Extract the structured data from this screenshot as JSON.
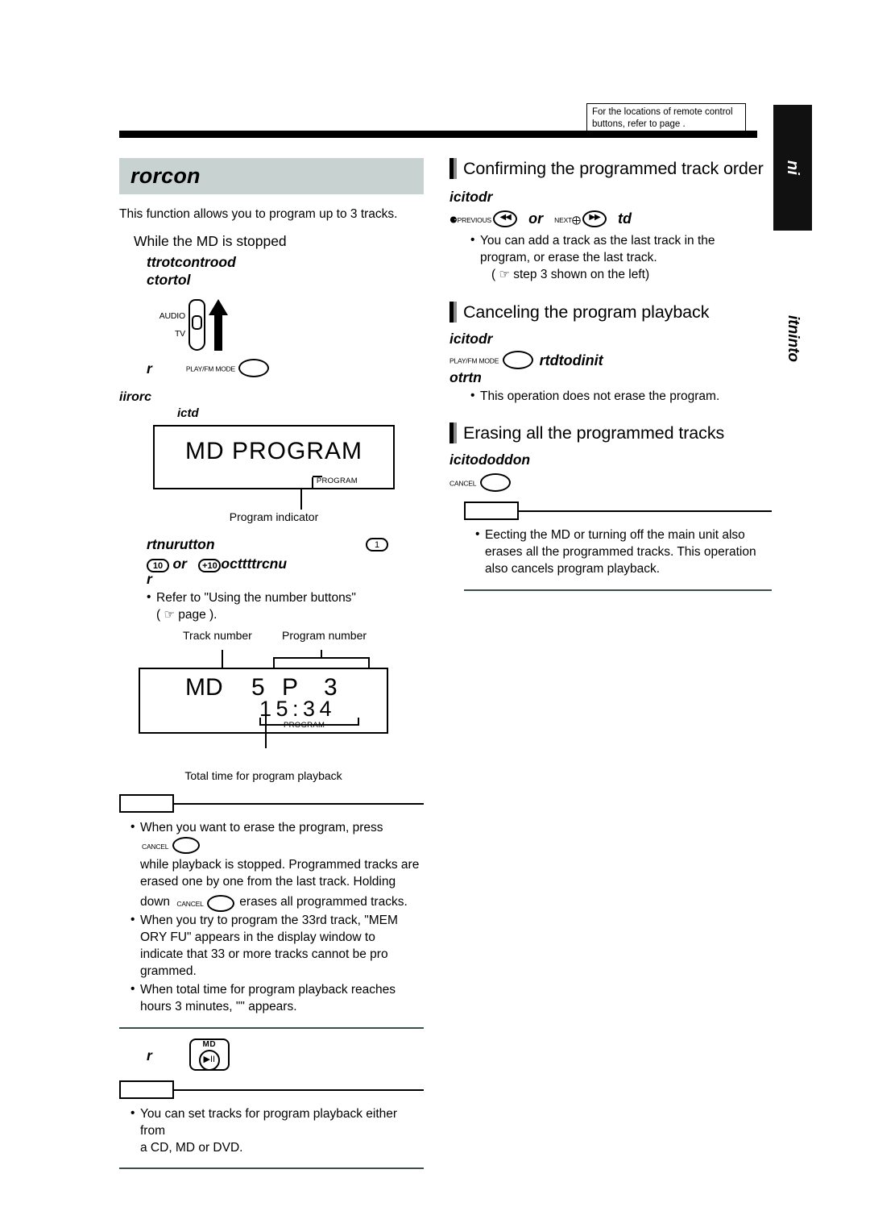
{
  "remote_note": {
    "line1": "For the locations of remote control",
    "line2": "buttons, refer to page ."
  },
  "side_tab": {
    "label": "ni",
    "sub_label": "itninto"
  },
  "left_column": {
    "chapter_title": "rorcon",
    "intro": "This function allows you to program up to 3 tracks.",
    "subhead": "While the MD is stopped",
    "step1_line1": "ttrotcontrood",
    "step1_line2": "ctortol",
    "switch": {
      "label_audio": "AUDIO",
      "label_tv": "TV"
    },
    "step2_prefix": "r",
    "step2_button_caption": "PLAY/FM MODE",
    "step2_note": "iirorc",
    "step2_note2": "ictd",
    "display1": {
      "text": "MD  PROGRAM",
      "program_tag": "PROGRAM",
      "caption": "Program indicator"
    },
    "step3_line1": "rtnurutton",
    "step3_button_1": "1",
    "step3_num_10": "10",
    "step3_or": "or",
    "step3_num_plus10": "+10",
    "step3_line2_tail": "octtttrcnu",
    "step3_line3": "r",
    "step3_bullet_1": "Refer to \"Using the number buttons\"",
    "step3_bullet_1b": "page ).",
    "display2": {
      "label_track": "Track number",
      "label_program": "Program number",
      "md": "MD",
      "track": "5",
      "p": "P",
      "prognum": "3",
      "time": "1 5 : 3 4",
      "program_tag": "PROGRAM",
      "caption": "Total time for program playback"
    },
    "note1": {
      "tab_label": "",
      "items": [
        "When you want to erase the program, press  ~CANCEL~  while playback is stopped. Programmed tracks are erased one by one from the last track. Holding down ~CANCEL~ erases all programmed tracks.",
        "When you try to program the 33rd track, \"MEM ORY FU\" appears in the display window to indicate that 33 or more tracks cannot be pro grammed.",
        "When total time for program playback reaches hours 3 minutes, \"\" appears."
      ],
      "item1_a": "When you want to erase the program, press",
      "item1_b": "while playback is stopped. Programmed tracks are",
      "item1_c": "erased one by one from the last track. Holding",
      "item1_d": "down",
      "item1_e": "erases all programmed tracks.",
      "item2_a": "When you try to program the 33rd track, \"MEM",
      "item2_b": "ORY FU\" appears in the display window to",
      "item2_c": "indicate that 33 or more tracks cannot be pro",
      "item2_d": "grammed.",
      "item3_a": "When total time for program playback reaches",
      "item3_b": "hours 3 minutes, \"\" appears."
    },
    "step4_prefix": "r",
    "step4_button_caption": "MD",
    "step4_button_glyph": "▶II",
    "note2": {
      "tab_label": "",
      "item_a": "You can set tracks for program playback either from",
      "item_b": "a CD, MD or DVD."
    },
    "cancel_caption": "CANCEL"
  },
  "right_column": {
    "section1": {
      "title": "Confirming the programmed track order",
      "step_label": "icitodr",
      "btn_prev_caption": "PREVIOUS",
      "btn_prev_glyph": "◀◀",
      "or": "or",
      "btn_next_caption": "NEXT",
      "btn_next_glyph": "▶▶",
      "tail": "td",
      "bullet_a": "You can add a track as the last track in the",
      "bullet_b": "program, or erase the last track.",
      "bullet_c": "step 3 shown on the left)"
    },
    "section2": {
      "title": "Canceling the program playback",
      "step_label": "icitodr",
      "btn_caption": "PLAY/FM MODE",
      "tail": "rtdtodinit",
      "tail2": "otrtn",
      "bullet_a": "This operation does not erase the program."
    },
    "section3": {
      "title": "Erasing all the programmed tracks",
      "step_label": "icitododdon",
      "btn_caption": "CANCEL",
      "note": {
        "tab_label": "",
        "item_a": "Eecting the MD or turning off the main unit also",
        "item_b": "erases all the programmed tracks. This operation",
        "item_c": "also cancels program playback."
      }
    }
  },
  "colors": {
    "chapter_bar_bg": "#c8d2d1",
    "section_bar_dark": "#000000",
    "section_bar_gray": "#8c8c8c",
    "rule_black": "#000000",
    "note_rule": "#3d4f4c"
  }
}
